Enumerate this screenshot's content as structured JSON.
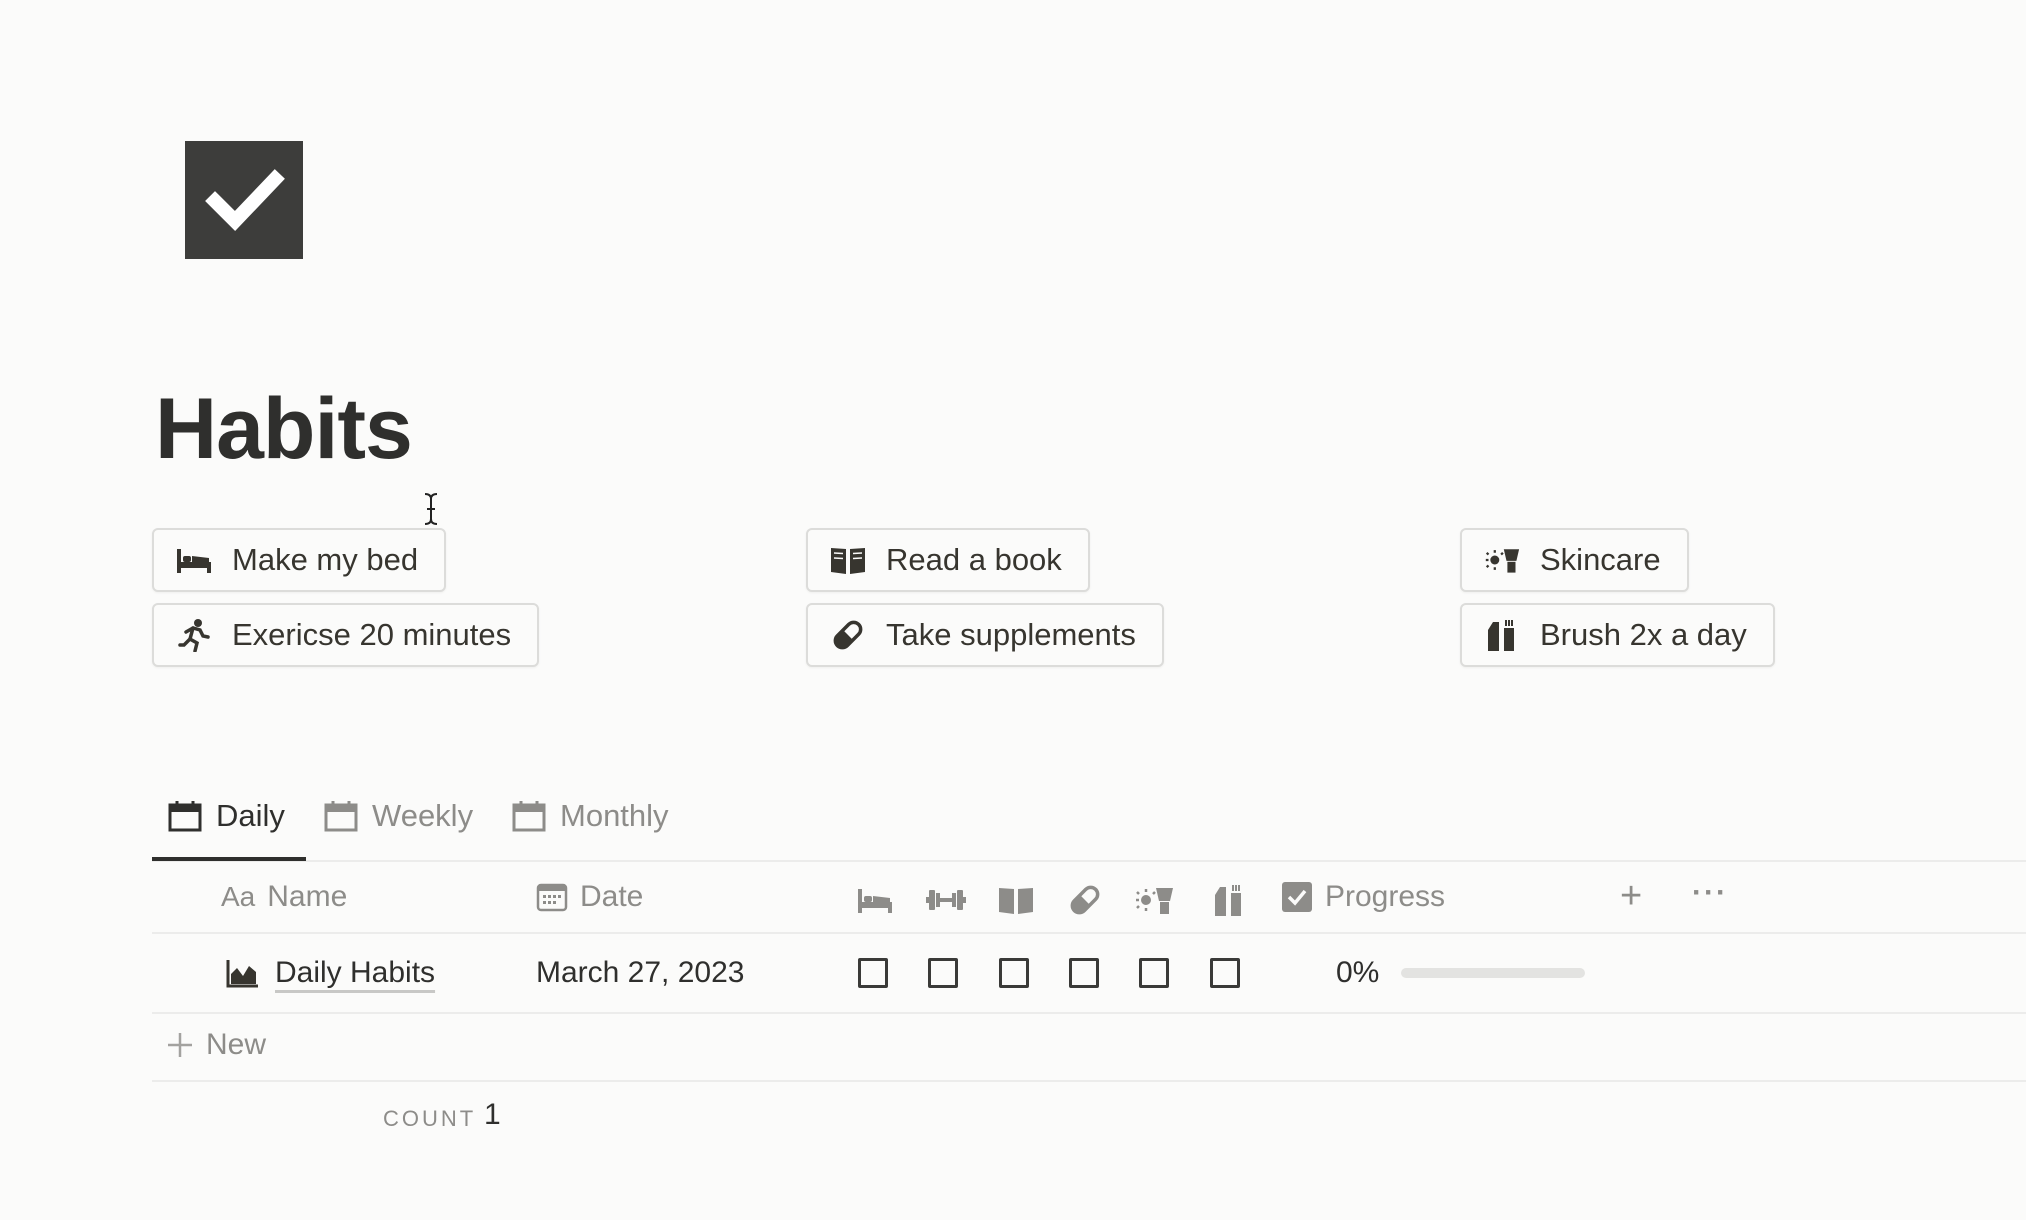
{
  "page": {
    "title": "Habits",
    "icon": "checkmark-icon"
  },
  "habit_buttons": [
    {
      "label": "Make my bed",
      "icon": "bed-icon"
    },
    {
      "label": "Exericse 20 minutes",
      "icon": "running-icon"
    },
    {
      "label": "Read a book",
      "icon": "book-icon"
    },
    {
      "label": "Take supplements",
      "icon": "pill-icon"
    },
    {
      "label": "Skincare",
      "icon": "skincare-icon"
    },
    {
      "label": "Brush 2x a day",
      "icon": "toothbrush-icon"
    }
  ],
  "tabs": [
    {
      "label": "Daily",
      "icon": "calendar-icon",
      "active": true
    },
    {
      "label": "Weekly",
      "icon": "calendar-icon",
      "active": false
    },
    {
      "label": "Monthly",
      "icon": "calendar-icon",
      "active": false
    }
  ],
  "table": {
    "columns": {
      "name_icon_text": "Aa",
      "name": "Name",
      "date": "Date",
      "habit_icons": [
        "bed-icon",
        "dumbbell-icon",
        "book-icon",
        "pill-icon",
        "skincare-icon",
        "toothbrush-icon"
      ],
      "progress": "Progress",
      "add": "+",
      "more": "···"
    },
    "rows": [
      {
        "name": "Daily Habits",
        "icon": "chart-icon",
        "date": "March 27, 2023",
        "checks": [
          false,
          false,
          false,
          false,
          false,
          false
        ],
        "progress_text": "0%",
        "progress_value": 0
      }
    ],
    "new_label": "New",
    "count_label": "COUNT",
    "count_value": "1"
  },
  "colors": {
    "text": "#37352f",
    "muted": "#8d8c89",
    "border": "#ececeb",
    "icon_bg": "#3d3d3b"
  }
}
